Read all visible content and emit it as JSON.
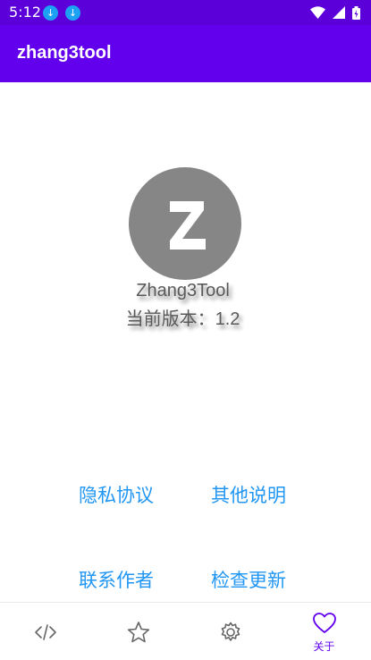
{
  "status_bar": {
    "time": "5:12",
    "icons": [
      "download-icon",
      "download-icon",
      "wifi-icon",
      "signal-icon",
      "battery-icon"
    ]
  },
  "app_bar": {
    "title": "zhang3tool"
  },
  "about": {
    "logo_letter": "Z",
    "app_name": "Zhang3Tool",
    "version": "当前版本：1.2"
  },
  "links": {
    "privacy": "隐私协议",
    "other_notes": "其他说明",
    "contact": "联系作者",
    "check_update": "检查更新"
  },
  "bottom_nav": {
    "items": [
      {
        "icon": "code-icon"
      },
      {
        "icon": "star-icon"
      },
      {
        "icon": "gear-icon"
      },
      {
        "icon": "heart-icon",
        "label": "关于",
        "active": true
      }
    ]
  },
  "colors": {
    "status_bar": "#5c00d9",
    "app_bar": "#6200ee",
    "link": "#2196f3",
    "logo_bg": "#868686",
    "active_nav": "#6200ee"
  }
}
